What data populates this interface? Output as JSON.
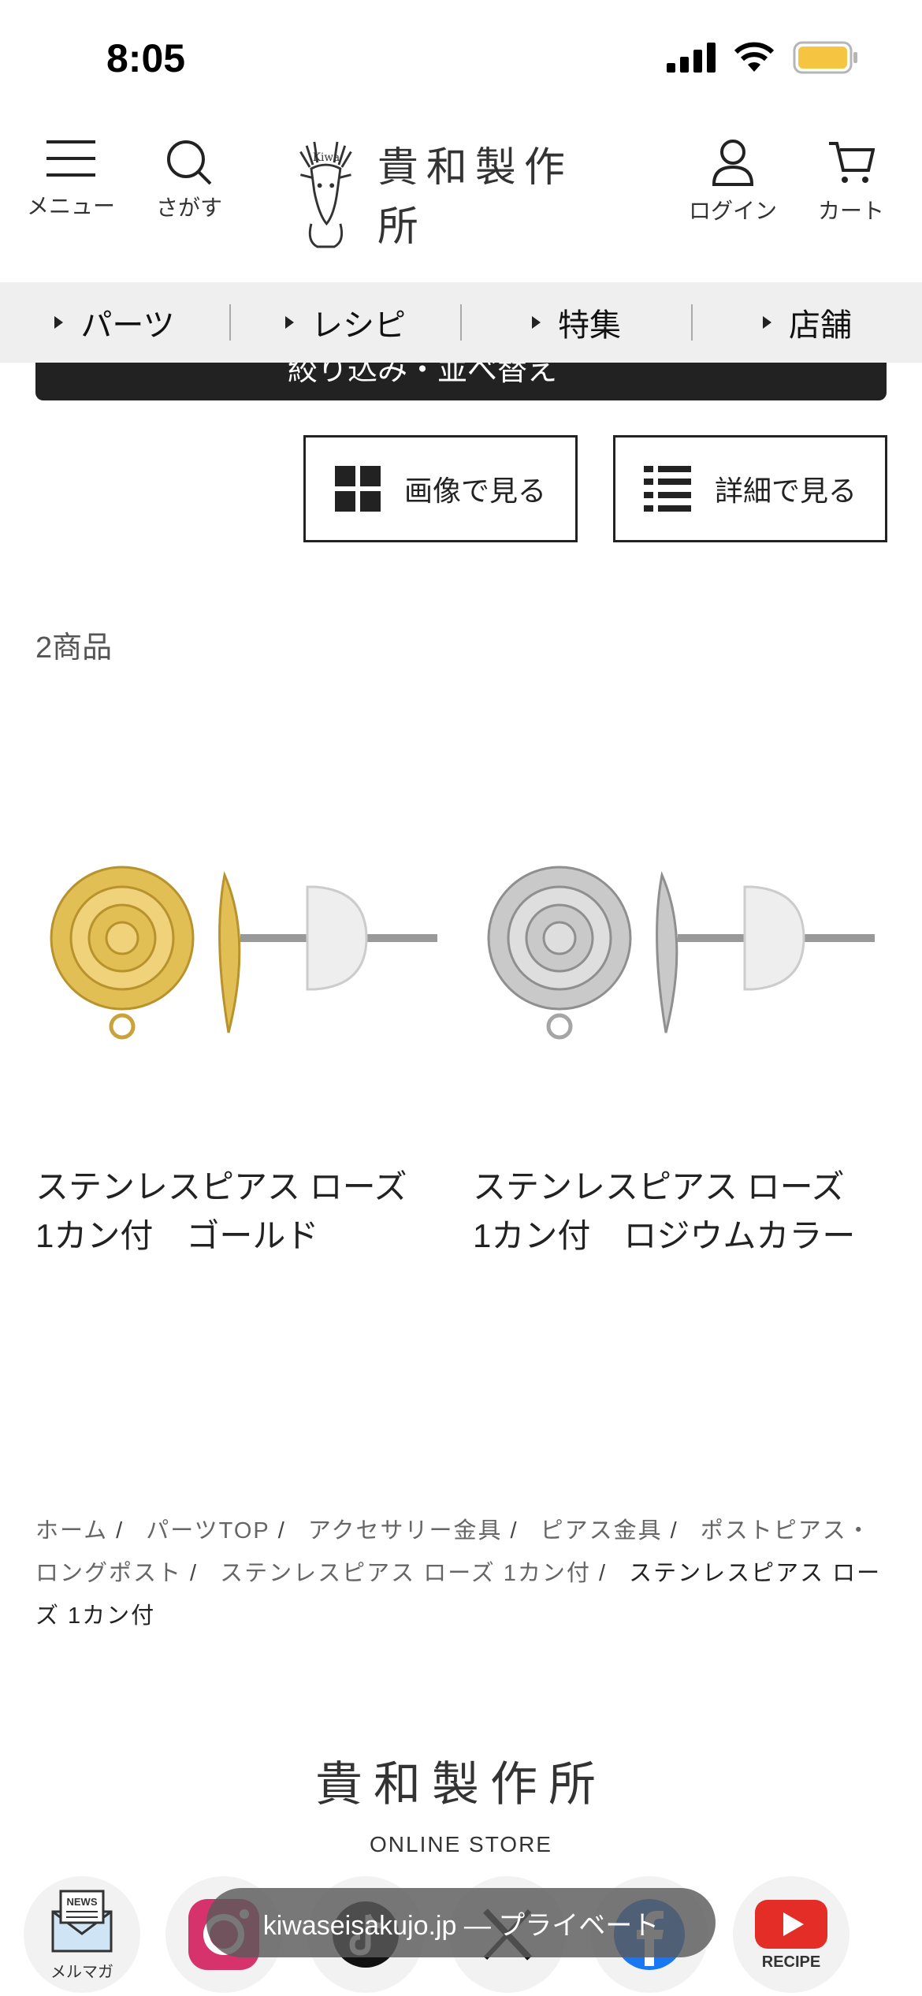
{
  "status": {
    "time": "8:05"
  },
  "header": {
    "menu_label": "メニュー",
    "search_label": "さがす",
    "logo_text": "貴和製作所",
    "login_label": "ログイン",
    "cart_label": "カート"
  },
  "nav": {
    "items": [
      "パーツ",
      "レシピ",
      "特集",
      "店舗"
    ]
  },
  "filter": {
    "label": "絞り込み・並べ替え"
  },
  "view": {
    "image_label": "画像で見る",
    "detail_label": "詳細で見る"
  },
  "results": {
    "count": "2商品"
  },
  "products": [
    {
      "line1": "ステンレスピアス ローズ",
      "line2": "1カン付　ゴールド",
      "color": "#d9b544"
    },
    {
      "line1": "ステンレスピアス ローズ",
      "line2": "1カン付　ロジウムカラー",
      "color": "#b8b8b8"
    }
  ],
  "breadcrumb": {
    "items": [
      "ホーム",
      "パーツTOP",
      "アクセサリー金具",
      "ピアス金具",
      "ポストピアス・ロングポスト",
      "ステンレスピアス ローズ 1カン付"
    ],
    "current": "ステンレスピアス ローズ 1カン付"
  },
  "footer": {
    "logo_text": "貴和製作所",
    "store_label": "ONLINE STORE"
  },
  "social": {
    "newsletter_label": "メルマガ",
    "recipe_label": "RECIPE",
    "news_badge": "NEWS"
  },
  "browser": {
    "url": "kiwaseisakujo.jp — プライベート"
  }
}
